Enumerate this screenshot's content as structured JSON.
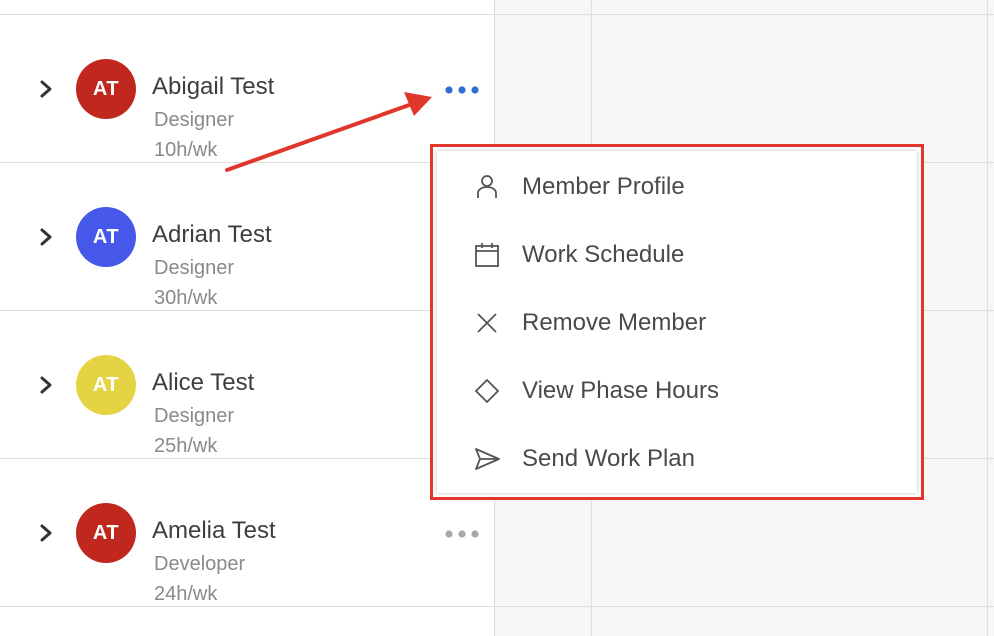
{
  "members": [
    {
      "initials": "AT",
      "name": "Abigail Test",
      "role": "Designer",
      "hours": "10h/wk",
      "avatar_color": "#c0281f"
    },
    {
      "initials": "AT",
      "name": "Adrian Test",
      "role": "Designer",
      "hours": "30h/wk",
      "avatar_color": "#4658ea"
    },
    {
      "initials": "AT",
      "name": "Alice Test",
      "role": "Designer",
      "hours": "25h/wk",
      "avatar_color": "#e4d444"
    },
    {
      "initials": "AT",
      "name": "Amelia Test",
      "role": "Developer",
      "hours": "24h/wk",
      "avatar_color": "#c0281f"
    }
  ],
  "menu": {
    "items": [
      {
        "label": "Member Profile",
        "icon": "person-icon"
      },
      {
        "label": "Work Schedule",
        "icon": "calendar-icon"
      },
      {
        "label": "Remove Member",
        "icon": "close-icon"
      },
      {
        "label": "View Phase Hours",
        "icon": "diamond-icon"
      },
      {
        "label": "Send Work Plan",
        "icon": "send-icon"
      }
    ]
  },
  "colors": {
    "active_dots": "#2f6fd0",
    "inactive_dots": "#a8a8a8",
    "highlight": "#e0362c",
    "arrow": "#e0362c"
  }
}
